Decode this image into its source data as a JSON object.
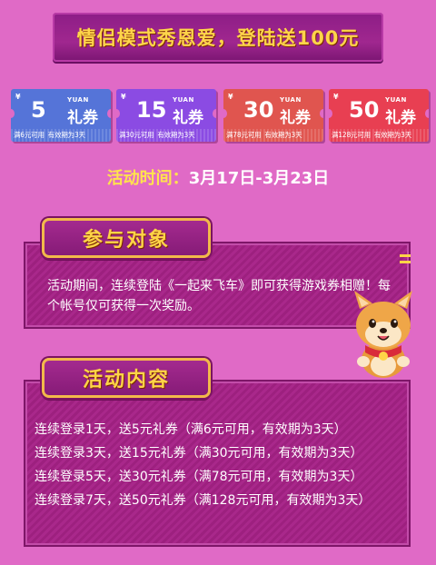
{
  "banner": {
    "title": "情侣模式秀恩爱，登陆送100元"
  },
  "coupons": [
    {
      "yen": "¥",
      "amount": "5",
      "yuan": "YUAN",
      "label": "礼券",
      "condition": "满6元可用",
      "validity": "有效期为3天",
      "color": "#5574d8"
    },
    {
      "yen": "¥",
      "amount": "15",
      "yuan": "YUAN",
      "label": "礼券",
      "condition": "满30元可用",
      "validity": "有效期为3天",
      "color": "#8b4be3"
    },
    {
      "yen": "¥",
      "amount": "30",
      "yuan": "YUAN",
      "label": "礼券",
      "condition": "满78元可用",
      "validity": "有效期为3天",
      "color": "#e0554f"
    },
    {
      "yen": "¥",
      "amount": "50",
      "yuan": "YUAN",
      "label": "礼券",
      "condition": "满128元可用",
      "validity": "有效期为3天",
      "color": "#e83f52"
    }
  ],
  "activity_time": {
    "label": "活动时间：",
    "value": "3月17日-3月23日"
  },
  "participants": {
    "title": "参与对象",
    "text": "活动期间，连续登陆《一起来飞车》即可获得游戏券相赠！每个帐号仅可获得一次奖励。"
  },
  "content": {
    "title": "活动内容",
    "rules": [
      "连续登录1天，送5元礼券（满6元可用，有效期为3天）",
      "连续登录3天，送15元礼券（满30元可用，有效期为3天）",
      "连续登录5天，送30元礼券（满78元可用，有效期为3天）",
      "连续登录7天，送50元礼券（满128元可用，有效期为3天）"
    ]
  },
  "mascot": {
    "icon": "shiba-dog-mascot-icon"
  },
  "colors": {
    "background": "#e06ac6",
    "panel": "#a0248a",
    "accent_gold": "#ffd447"
  }
}
